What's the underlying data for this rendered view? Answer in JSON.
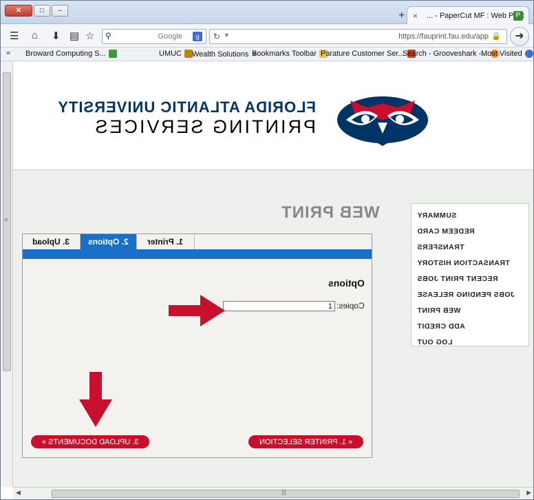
{
  "browser": {
    "tab_title": "PaperCut MF : Web Print - ...",
    "tab_close": "×",
    "new_tab": "+",
    "search_placeholder": "Google",
    "search_engine_icon": "google-icon",
    "url": "https://fauprint.fau.edu/app",
    "bookmarks": [
      {
        "label": "Most Visited",
        "icon": "globe-icon",
        "color": "#3b6fd4"
      },
      {
        "label": "Search - Grooveshark -...",
        "icon": "grooveshark-icon",
        "color": "#f28c28"
      },
      {
        "label": "Parature Customer Ser...",
        "icon": "parature-icon",
        "color": "#c04a24"
      },
      {
        "label": "Bookmarks Toolbar",
        "icon": "folder-icon",
        "color": "#e4c25f"
      },
      {
        "label": "Wealth Solutions",
        "icon": "star-icon",
        "color": "#b05"
      },
      {
        "label": "UMUC",
        "icon": "umuc-icon",
        "color": "#b8860b"
      },
      {
        "label": "Broward Computing S...",
        "icon": "sheet-icon",
        "color": "#3c9a3c"
      }
    ],
    "overflow": "»"
  },
  "header": {
    "line1": "FLORIDA ATLANTIC UNIVERSITY",
    "line2": "PRINTING SERVICES",
    "brand_color": "#003366",
    "accent_color": "#c8102e"
  },
  "page": {
    "title": "WEB PRINT"
  },
  "menu": {
    "items": [
      "SUMMARY",
      "REDEEM CARD",
      "TRANSFERS",
      "TRANSACTION HISTORY",
      "RECENT PRINT JOBS",
      "JOBS PENDING RELEASE",
      "WEB PRINT",
      "ADD CREDIT",
      "LOG OUT"
    ]
  },
  "wizard": {
    "tabs": [
      "1. Printer",
      "2. Options",
      "3. Upload"
    ],
    "active_tab": "2. Options",
    "section_title": "Options",
    "copies_label": "Copies:",
    "copies_value": "1",
    "prev_button": "« 1. PRINTER SELECTION",
    "next_button": "3. UPLOAD DOCUMENTS »",
    "tab_color": "#1a6fc9",
    "button_color": "#c8102e"
  }
}
